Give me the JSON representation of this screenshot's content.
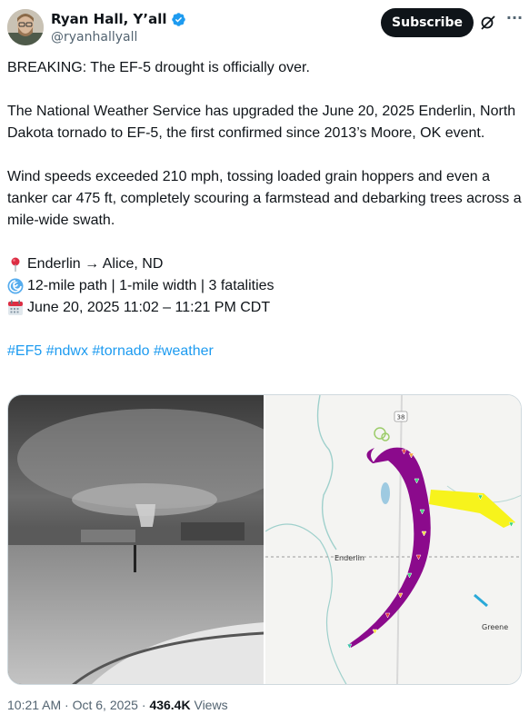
{
  "author": {
    "name": "Ryan Hall, Y’all",
    "handle": "@ryanhallyall"
  },
  "actions": {
    "subscribe_label": "Subscribe",
    "more_label": "···"
  },
  "tweet": {
    "line1": "BREAKING: The EF-5 drought is officially over.",
    "para2": "The National Weather Service has upgraded the June 20, 2025 Enderlin, North Dakota tornado to EF-5, the first confirmed since 2013’s Moore, OK event.",
    "para3": "Wind speeds exceeded 210 mph, tossing loaded grain hoppers and even a tanker car 475 ft, completely scouring a farmstead and debarking trees across a mile-wide swath.",
    "location": "Enderlin → Alice, ND",
    "stats": "12-mile path | 1-mile width | 3 fatalities",
    "datetime": "June 20, 2025 11:02 – 11:21 PM CDT",
    "hashtags": [
      "#EF5",
      "#ndwx",
      "#tornado",
      "#weather"
    ]
  },
  "map": {
    "highway_label": "38",
    "town_enderlin": "Enderlin",
    "town_greene": "Greene"
  },
  "meta": {
    "time": "10:21 AM · Oct 6, 2025",
    "separator": " · ",
    "views_count": "436.4K",
    "views_label": " Views"
  },
  "icons": {
    "verified": "verified-badge-icon",
    "grok": "grok-icon",
    "pin": "round-pushpin-icon",
    "cyclone": "cyclone-icon",
    "calendar": "calendar-icon"
  },
  "colors": {
    "accent": "#1d9bf0",
    "button_bg": "#0f1419",
    "secondary_text": "#536471",
    "damage_path": "#8b0a8c",
    "secondary_path": "#f7f31c"
  }
}
